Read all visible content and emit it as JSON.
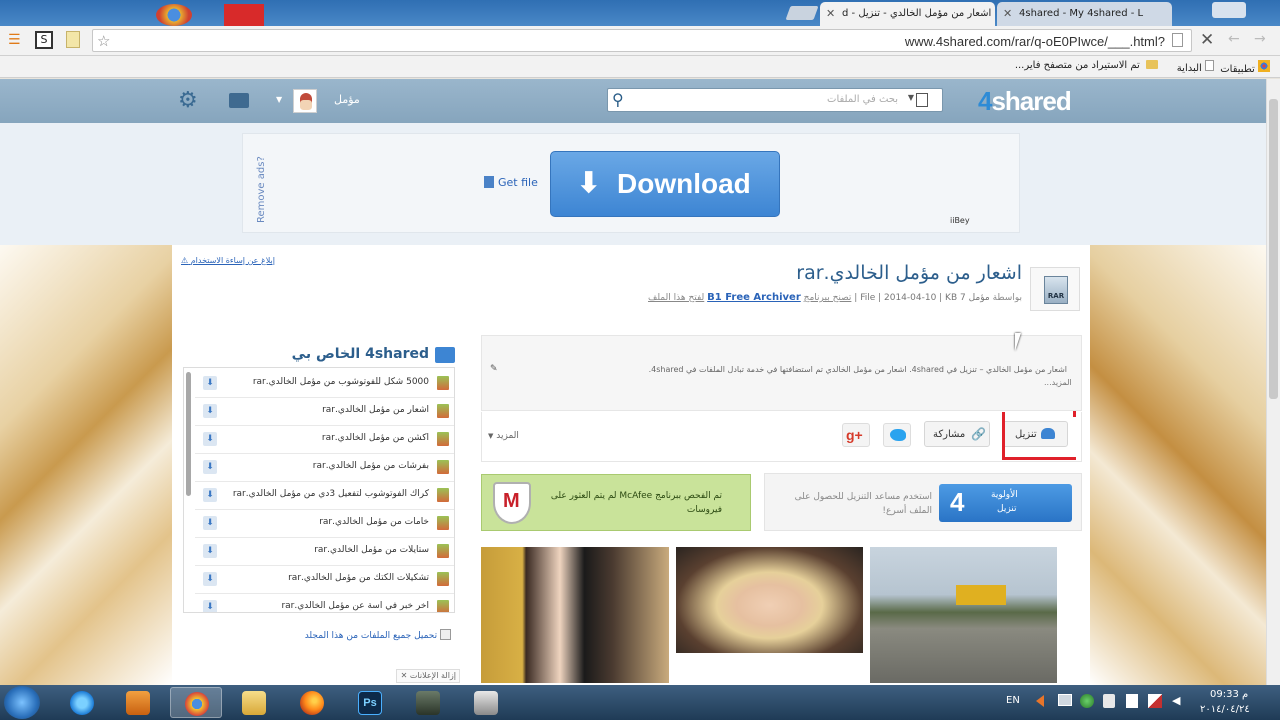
{
  "browser": {
    "tabs": [
      {
        "title": "اشعار من مؤمل الخالدي - تنزيل - d"
      },
      {
        "title": "4shared - My 4shared - L"
      }
    ],
    "url": "www.4shared.com/rar/q-oE0PIwce/___.html?",
    "bookmarks": [
      {
        "label": "تطبيقات"
      },
      {
        "label": "البداية"
      },
      {
        "label": "تم الاستيراد من متصفح فاير..."
      }
    ]
  },
  "header": {
    "logo_prefix": "4",
    "logo_suffix": "shared",
    "search_placeholder": "بحث في الملفات",
    "username": "مؤمل"
  },
  "ad": {
    "remove_ads": "Remove ads?",
    "get_file": "Get file",
    "download_label": "Download",
    "ad_tag": "iiBey"
  },
  "file": {
    "title": "اشعار من مؤمل الخالدي.rar",
    "report": "إبلاغ عن إساءة الاستخدام",
    "byline": "بواسطة",
    "meta": "مؤمل 7 File | 2014-04-10 | KB |",
    "recommend": "تصنح ببرنامج",
    "archiver": "B1 Free Archiver",
    "archiver_tail": "لفتح هذا الملف",
    "description": "اشعار من مؤمل الخالدي – تنزيل في 4shared. اشعار من مؤمل الخالدي تم استضافتها في خدمة تبادل الملفات في 4shared.",
    "more": "المزيد..."
  },
  "actions": {
    "download": "تنزيل",
    "share": "مشاركة",
    "more": "المزيد",
    "priority_line1": "الأولوية",
    "priority_line2": "تنزيل",
    "priority_num": "4",
    "priority_help": "استخدم مساعد التنزيل للحصول على الملف أسرع!",
    "mcafee_text": "تم الفحص ببرنامج McAfee لم يتم العثور على فيروسات"
  },
  "sidebar": {
    "title": "4shared الخاص بي",
    "items": [
      {
        "name": "5000 شكل للفوتوشوب من مؤمل الخالدي.rar"
      },
      {
        "name": "اشعار من مؤمل الخالدي.rar"
      },
      {
        "name": "اكشن من مؤمل الخالدي.rar"
      },
      {
        "name": "بفرشات من مؤمل الخالدي.rar"
      },
      {
        "name": "كراك الفوتوشوب لتفعيل 3دي من مؤمل الخالدي.rar"
      },
      {
        "name": "خامات من مؤمل الخالدي.rar"
      },
      {
        "name": "ستايلات من مؤمل الخالدي.rar"
      },
      {
        "name": "تشكيلات الكتك من مؤمل الخالدي.rar"
      },
      {
        "name": "اخر خبر في اسة عن مؤمل الخالدي.rar"
      }
    ],
    "download_all": "تحميل جميع الملفات من هذا المجلد",
    "remove_ads": "إزالة الإعلانات"
  },
  "taskbar": {
    "lang": "EN",
    "time": "09:33 م",
    "date": "٢٠١٤/٠٤/٢٤"
  },
  "colors": {
    "accent": "#2e8bd6",
    "header": "#8eabc2",
    "download_btn": "#4a8fd9",
    "annotation": "#e0202a"
  }
}
